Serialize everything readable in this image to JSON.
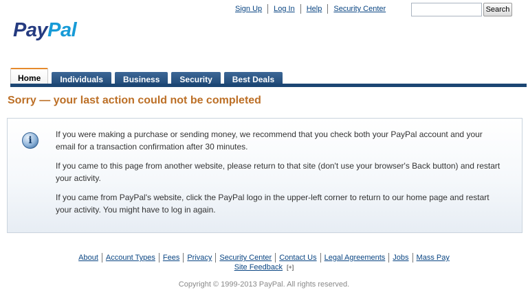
{
  "header": {
    "top_links": [
      "Sign Up",
      "Log In",
      "Help",
      "Security Center"
    ],
    "search_button": "Search",
    "search_value": ""
  },
  "logo": {
    "pay": "Pay",
    "pal": "Pal"
  },
  "tabs": [
    {
      "label": "Home",
      "active": true
    },
    {
      "label": "Individuals"
    },
    {
      "label": "Business"
    },
    {
      "label": "Security"
    },
    {
      "label": "Best Deals"
    }
  ],
  "heading": "Sorry — your last action could not be completed",
  "info": {
    "icon": "info-icon",
    "paragraphs": [
      "If you were making a purchase or sending money, we recommend that you check both your PayPal account and your email for a transaction confirmation after 30 minutes.",
      "If you came to this page from another website, please return to that site (don't use your browser's Back button) and restart your activity.",
      "If you came from PayPal's website, click the PayPal logo in the upper-left corner to return to our home page and restart your activity. You might have to log in again."
    ]
  },
  "footer": {
    "links": [
      "About",
      "Account Types",
      "Fees",
      "Privacy",
      "Security Center",
      "Contact Us",
      "Legal Agreements",
      "Jobs",
      "Mass Pay"
    ],
    "feedback": "Site Feedback",
    "feedback_icon": "[+]",
    "copyright": "Copyright © 1999-2013 PayPal. All rights reserved."
  },
  "colors": {
    "tab_blue": "#1c4673",
    "heading_orange": "#bc6f26",
    "link_blue": "#084482"
  }
}
